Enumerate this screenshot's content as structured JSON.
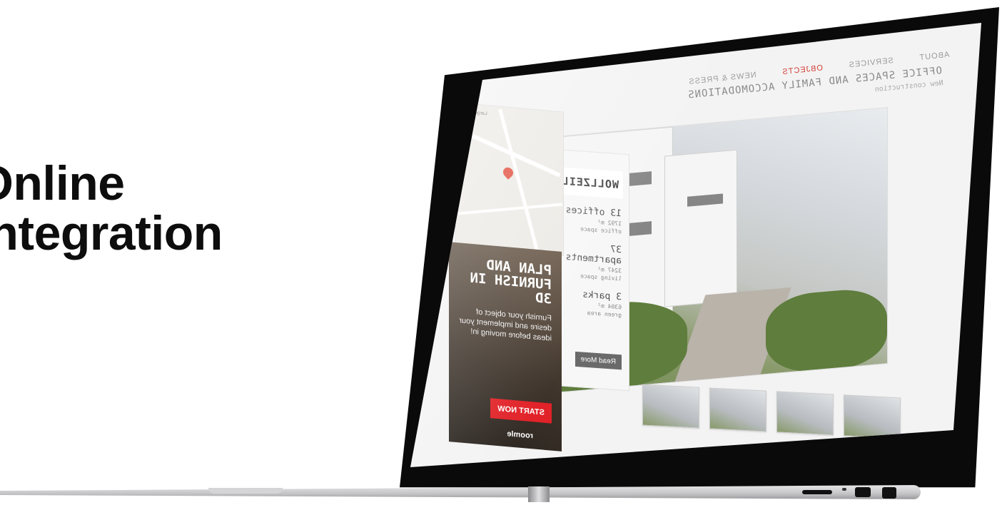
{
  "headline": {
    "line1": "Online",
    "line2": "Integration"
  },
  "site": {
    "nav": {
      "items": [
        "ABOUT",
        "SERVICES",
        "OBJECTS",
        "NEWS & PRESS"
      ],
      "active_index": 2
    },
    "title": "OFFICE SPACES AND FAMILY ACCOMODATIONS",
    "subtitle": "New construction",
    "property": {
      "name": "WOLLZEILE",
      "stats": [
        {
          "big": "13 offices",
          "small1": "1792 m²",
          "small2": "office space"
        },
        {
          "big": "37 apartments",
          "small1": "3247 m²",
          "small2": "living space"
        },
        {
          "big": "3 parks",
          "small1": "6304 m²",
          "small2": "green area"
        }
      ],
      "read_more": "Read More"
    },
    "map": {
      "link": "Larger map"
    },
    "promo": {
      "title": "PLAN AND FURNISH IN 3D",
      "text": "Furnish your object of desire and implement your ideas before moving in!",
      "button": "START NOW",
      "logo": "roomle"
    },
    "colors": {
      "accent": "#d23b35",
      "button_red": "#e12228"
    }
  }
}
